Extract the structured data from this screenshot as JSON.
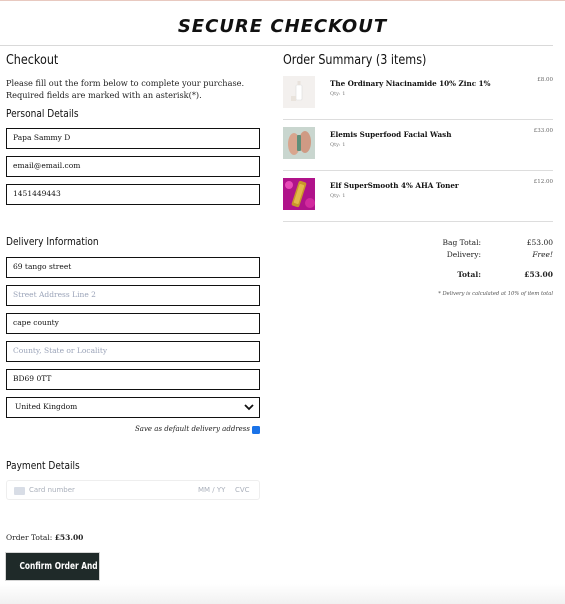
{
  "brand": "SECURE CHECKOUT",
  "checkout": {
    "title": "Checkout",
    "intro": "Please fill out the form below to complete your purchase. Required fields are marked with an asterisk(*).",
    "personal_title": "Personal Details",
    "full_name": "Papa Sammy D",
    "email": "email@email.com",
    "phone": "1451449443",
    "delivery_title": "Delivery Information",
    "address1": "69 tango street",
    "address2_placeholder": "Street Address Line 2",
    "town": "cape county",
    "county_placeholder": "County, State or Locality",
    "postcode": "BD69 0TT",
    "country": "United Kingdom",
    "save_default_label": "Save as default delivery address",
    "save_default_checked": true,
    "payment_title": "Payment Details",
    "card_placeholder": "Card number",
    "expiry_placeholder": "MM / YY",
    "cvc_placeholder": "CVC",
    "order_total_label": "Order Total:",
    "order_total_value": "£53.00",
    "confirm_label": "Confirm Order And Pay"
  },
  "summary": {
    "title": "Order Summary (3 items)",
    "items": [
      {
        "name": "The Ordinary Niacinamide 10% Zinc 1%",
        "qty": "Qty: 1",
        "price": "£8.00"
      },
      {
        "name": "Elemis Superfood Facial Wash",
        "qty": "Qty: 1",
        "price": "£33.00"
      },
      {
        "name": "Elf SuperSmooth 4% AHA Toner",
        "qty": "Qty: 1",
        "price": "£12.00"
      }
    ],
    "bag_total_label": "Bag Total:",
    "bag_total_value": "£53.00",
    "delivery_label": "Delivery:",
    "delivery_value": "Free!",
    "total_label": "Total:",
    "total_value": "£53.00",
    "delivery_note": "* Delivery is calculated at 10% of item total"
  },
  "colors": {
    "button_bg": "#1f2a29",
    "checkbox": "#1a73e8",
    "placeholder": "#9aa3b8"
  }
}
